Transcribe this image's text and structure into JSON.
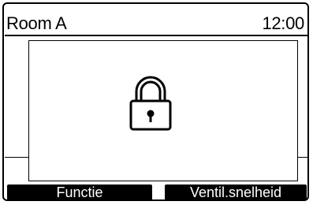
{
  "header": {
    "title": "Room A",
    "time": "12:00"
  },
  "dialog": {
    "icon": "lock-icon"
  },
  "softkeys": {
    "left_label": "Functie",
    "right_label": "Ventil.snelheid"
  },
  "colors": {
    "foreground": "#000000",
    "background": "#ffffff"
  }
}
